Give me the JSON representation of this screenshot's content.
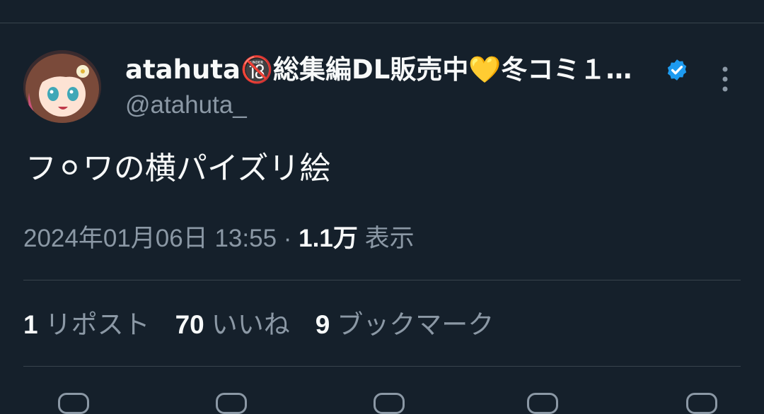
{
  "tweet": {
    "author": {
      "display_name": "atahuta🔞総集編DL販売中💛冬コミ１…",
      "handle": "@atahuta_",
      "verified": true,
      "avatar": "avatar-icon"
    },
    "text": "フ⚪ワの横パイズリ絵",
    "meta": {
      "timestamp": "2024年01月06日 13:55",
      "separator": "·",
      "views_count": "1.1万",
      "views_label": "表示"
    },
    "stats": [
      {
        "count": "1",
        "label": "リポスト"
      },
      {
        "count": "70",
        "label": "いいね"
      },
      {
        "count": "9",
        "label": "ブックマーク"
      }
    ]
  },
  "colors": {
    "background": "#15202b",
    "text_primary": "#f7f9f9",
    "text_secondary": "#8b98a5",
    "divider": "#38444d",
    "verified_badge": "#1d9bf0"
  },
  "icons": {
    "more": "more-vertical-icon",
    "verified": "verified-badge-icon"
  }
}
